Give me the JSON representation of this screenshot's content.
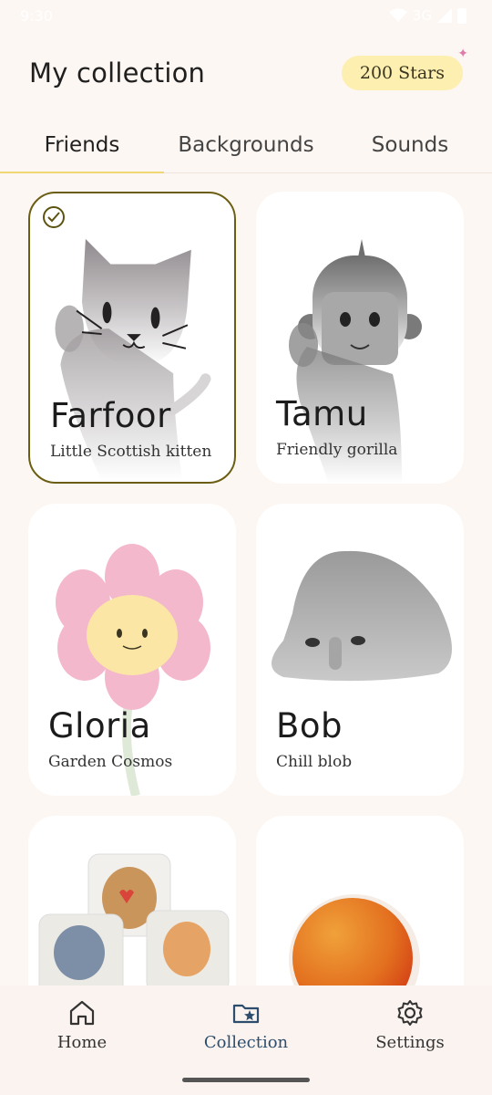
{
  "status_bar": {
    "time": "9:30",
    "network": "3G"
  },
  "header": {
    "title": "My collection",
    "stars": "200 Stars"
  },
  "tabs": [
    {
      "label": "Friends",
      "selected": true
    },
    {
      "label": "Backgrounds",
      "selected": false
    },
    {
      "label": "Sounds",
      "selected": false
    }
  ],
  "cards": [
    {
      "name": "Farfoor",
      "description": "Little Scottish kitten",
      "selected": true
    },
    {
      "name": "Tamu",
      "description": "Friendly gorilla",
      "selected": false
    },
    {
      "name": "Gloria",
      "description": "Garden Cosmos",
      "selected": false
    },
    {
      "name": "Bob",
      "description": "Chill blob",
      "selected": false
    },
    {
      "name": "",
      "description": "",
      "selected": false
    },
    {
      "name": "",
      "description": "",
      "selected": false
    }
  ],
  "bottom_nav": [
    {
      "label": "Home",
      "icon": "home-icon",
      "active": false
    },
    {
      "label": "Collection",
      "icon": "collection-icon",
      "active": true
    },
    {
      "label": "Settings",
      "icon": "settings-icon",
      "active": false
    }
  ],
  "colors": {
    "background": "#fdf7f3",
    "accent_tab": "#f0d774",
    "stars_badge": "#fcefb0",
    "selected_border": "#6b5e12",
    "nav_active": "#2c4d6e"
  }
}
